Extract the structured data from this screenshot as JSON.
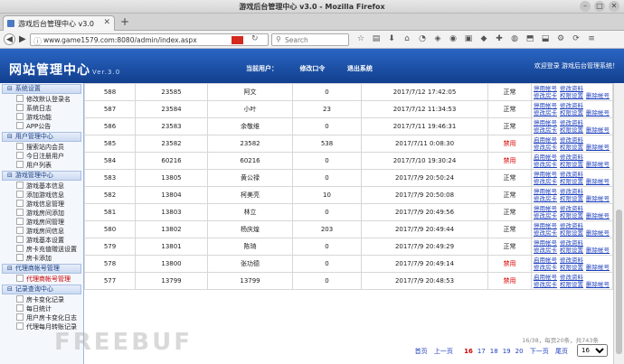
{
  "window": {
    "title": "游戏后台管理中心 v3.0 - Mozilla Firefox"
  },
  "tab": {
    "label": "游戏后台管理中心 v3.0",
    "close": "✕",
    "new": "+"
  },
  "nav": {
    "url": "www.game1579.com:8080/admin/index.aspx",
    "search_placeholder": "Search"
  },
  "app": {
    "brand": "网站管理中心",
    "version": "Ver.3.0",
    "header_current_user": "当前用户：",
    "header_change_pwd": "修改口令",
    "header_logout": "退出系统",
    "welcome": "欢迎登录 游戏后台管理系统！"
  },
  "sidebar": {
    "groups": [
      {
        "title": "系统设置",
        "items": [
          "修改默认登录名",
          "系统日志",
          "游戏功能",
          "APP公告"
        ]
      },
      {
        "title": "用户管理中心",
        "items": [
          "搜索站内会员",
          "今日注册用户",
          "用户列表"
        ]
      },
      {
        "title": "游戏管理中心",
        "items": [
          "游戏基本信息",
          "添加游戏信息",
          "游戏信息管理",
          "游戏房间添加",
          "游戏房间管理",
          "游戏房间信息",
          "游戏基本设置",
          "房卡充值赠送设置",
          "房卡添加"
        ]
      },
      {
        "title": "代理商帐号管理",
        "items": [
          "代理商帐号管理"
        ]
      },
      {
        "title": "记录查询中心",
        "items": [
          "房卡变化记录",
          "每日统计",
          "用户房卡变化日志",
          "代理每月转账记录"
        ]
      }
    ]
  },
  "ops": {
    "disable": "停用帐号",
    "enable": "启用帐号",
    "edit": "修改资料",
    "addcard": "修改房卡",
    "perm": "权限设置",
    "del": "删除帐号"
  },
  "rows": [
    {
      "id": "588",
      "uid": "23585",
      "name": "阿文",
      "cards": "0",
      "time": "2017/7/12 17:42:05",
      "status": "正常",
      "ban": false
    },
    {
      "id": "587",
      "uid": "23584",
      "name": "小叶",
      "cards": "23",
      "time": "2017/7/12 11:34:53",
      "status": "正常",
      "ban": false
    },
    {
      "id": "586",
      "uid": "23583",
      "name": "余敬维",
      "cards": "0",
      "time": "2017/7/11 19:46:31",
      "status": "正常",
      "ban": false
    },
    {
      "id": "585",
      "uid": "23582",
      "name": "23582",
      "cards": "538",
      "time": "2017/7/11 0:08:30",
      "status": "禁用",
      "ban": true
    },
    {
      "id": "584",
      "uid": "60216",
      "name": "60216",
      "cards": "0",
      "time": "2017/7/10 19:30:24",
      "status": "禁用",
      "ban": true
    },
    {
      "id": "583",
      "uid": "13805",
      "name": "黄公禄",
      "cards": "0",
      "time": "2017/7/9 20:50:24",
      "status": "正常",
      "ban": false
    },
    {
      "id": "582",
      "uid": "13804",
      "name": "柯美亮",
      "cards": "10",
      "time": "2017/7/9 20:50:08",
      "status": "正常",
      "ban": false
    },
    {
      "id": "581",
      "uid": "13803",
      "name": "林立",
      "cards": "0",
      "time": "2017/7/9 20:49:56",
      "status": "正常",
      "ban": false
    },
    {
      "id": "580",
      "uid": "13802",
      "name": "杨庆煌",
      "cards": "203",
      "time": "2017/7/9 20:49:44",
      "status": "正常",
      "ban": false
    },
    {
      "id": "579",
      "uid": "13801",
      "name": "陈琦",
      "cards": "0",
      "time": "2017/7/9 20:49:29",
      "status": "正常",
      "ban": false
    },
    {
      "id": "578",
      "uid": "13800",
      "name": "张功德",
      "cards": "0",
      "time": "2017/7/9 20:49:14",
      "status": "禁用",
      "ban": true
    },
    {
      "id": "577",
      "uid": "13799",
      "name": "13799",
      "cards": "0",
      "time": "2017/7/9 20:48:53",
      "status": "禁用",
      "ban": true
    }
  ],
  "pager": {
    "info": "16/38，每页20条，共743条",
    "first": "首页",
    "prev": "上一页",
    "pages": [
      "16",
      "17",
      "18",
      "19",
      "20"
    ],
    "current": "16",
    "next": "下一页",
    "last": "尾页",
    "select": "16"
  },
  "watermark": "FREEBUF",
  "colors": {
    "header_top": "#2a66c4",
    "header_bottom": "#123f8e",
    "link": "#1d3fbd",
    "ban": "#dd0000"
  }
}
